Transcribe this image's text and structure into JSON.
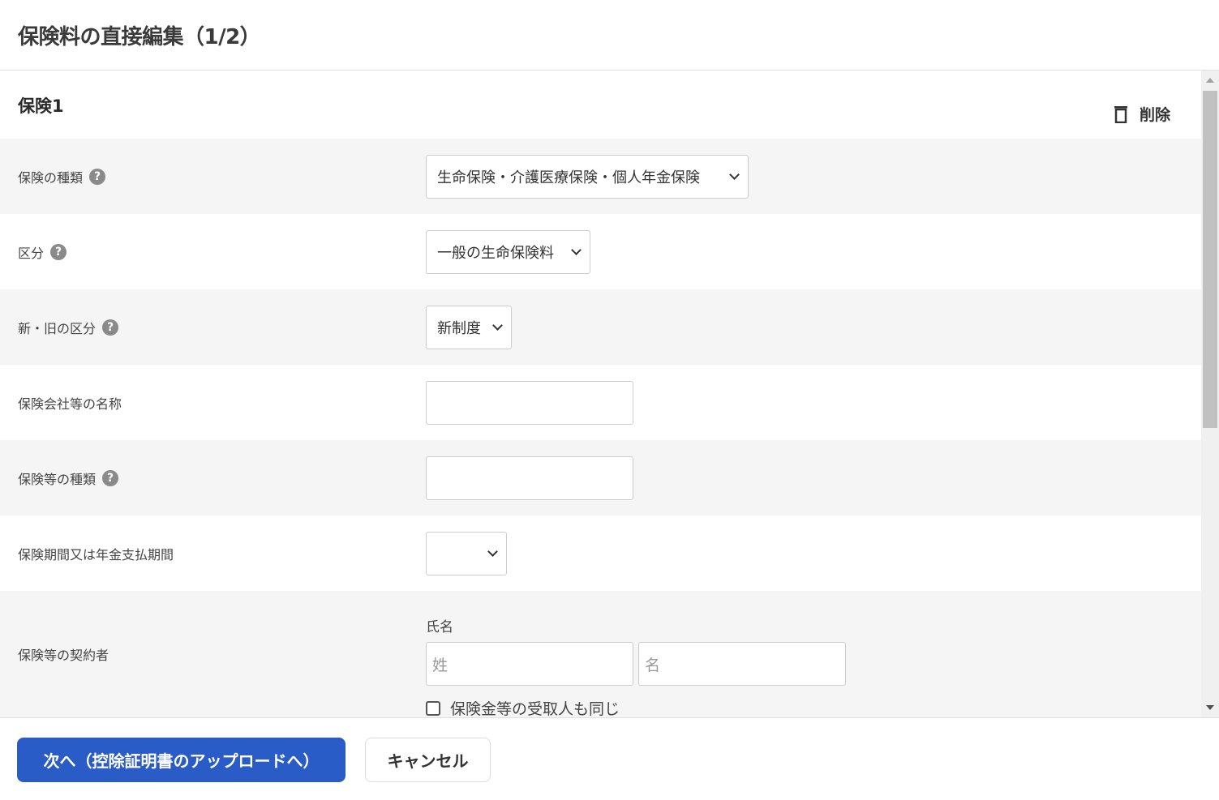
{
  "title": "保険料の直接編集（1/2）",
  "section": {
    "title": "保険1",
    "delete_label": "削除"
  },
  "fields": {
    "type": {
      "label": "保険の種類",
      "value": "生命保険・介護医療保険・個人年金保険"
    },
    "category": {
      "label": "区分",
      "value": "一般の生命保険料"
    },
    "system": {
      "label": "新・旧の区分",
      "value": "新制度"
    },
    "company": {
      "label": "保険会社等の名称",
      "value": ""
    },
    "kind": {
      "label": "保険等の種類",
      "value": ""
    },
    "period": {
      "label": "保険期間又は年金支払期間",
      "value": ""
    },
    "contractor": {
      "label": "保険等の契約者",
      "sub_label": "氏名",
      "last_placeholder": "姓",
      "first_placeholder": "名",
      "same_label": "保険金等の受取人も同じ"
    }
  },
  "footer": {
    "next_label": "次へ（控除証明書のアップロードへ）",
    "cancel_label": "キャンセル"
  }
}
